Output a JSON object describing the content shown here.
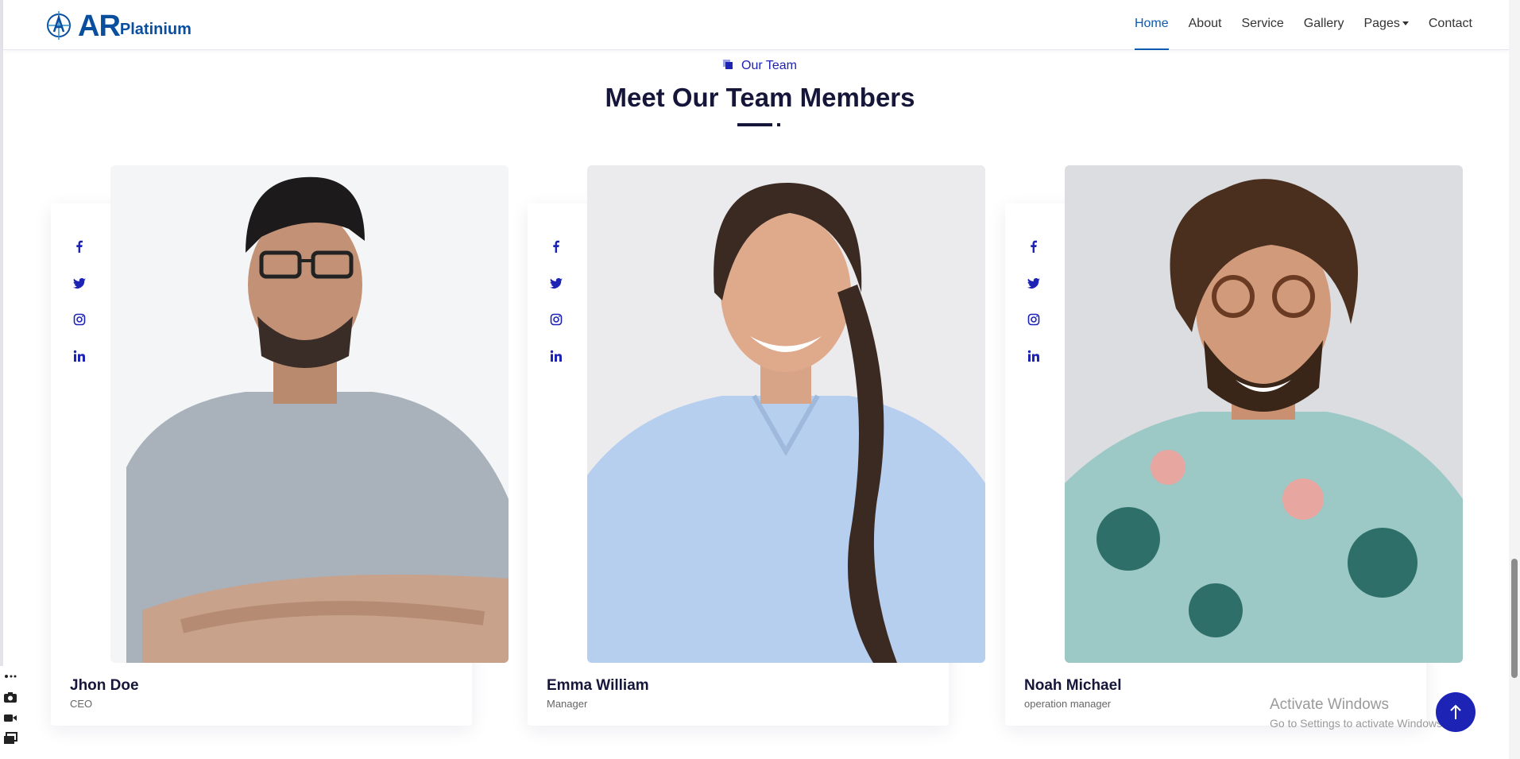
{
  "brand": {
    "name_main": "AR",
    "name_sub": "Platinium"
  },
  "nav": {
    "items": [
      {
        "label": "Home",
        "active": true
      },
      {
        "label": "About",
        "active": false
      },
      {
        "label": "Service",
        "active": false
      },
      {
        "label": "Gallery",
        "active": false
      },
      {
        "label": "Pages",
        "active": false
      },
      {
        "label": "Contact",
        "active": false
      }
    ]
  },
  "section": {
    "kicker": "Our Team",
    "title": "Meet Our Team Members"
  },
  "team": [
    {
      "name": "Jhon Doe",
      "role": "CEO"
    },
    {
      "name": "Emma William",
      "role": "Manager"
    },
    {
      "name": "Noah Michael",
      "role": "operation manager"
    }
  ],
  "socials": [
    "facebook-icon",
    "twitter-icon",
    "instagram-icon",
    "linkedin-icon"
  ],
  "watermark": {
    "title": "Activate Windows",
    "subtitle": "Go to Settings to activate Windows."
  },
  "colors": {
    "accent": "#1d23b5",
    "brand": "#0a4f9e",
    "heading": "#15163a"
  }
}
